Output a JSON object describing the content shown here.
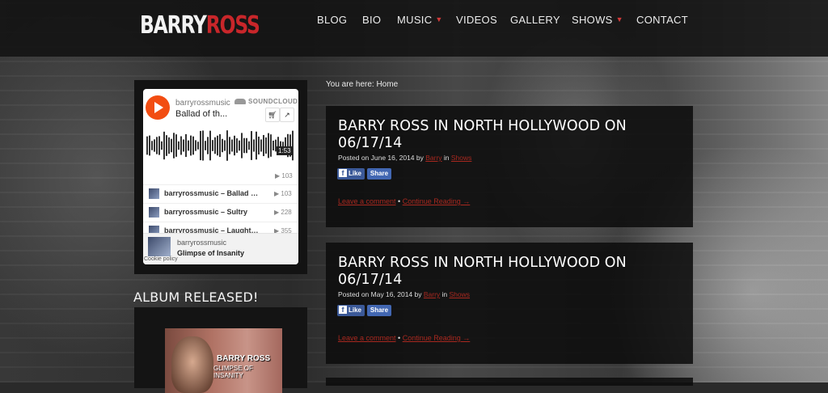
{
  "header": {
    "logo_part1": "BARRY",
    "logo_part2": "ROSS",
    "nav": [
      {
        "label": "BLOG"
      },
      {
        "label": "BIO"
      },
      {
        "label": "MUSIC"
      },
      {
        "label": "VIDEOS"
      },
      {
        "label": "GALLERY"
      },
      {
        "label": "SHOWS"
      },
      {
        "label": "CONTACT"
      }
    ]
  },
  "soundcloud": {
    "user": "barryrossmusic",
    "track_title": "Ballad of th...",
    "brand": "SOUNDCLOUD",
    "duration": "1:53",
    "plays": "103",
    "tracks": [
      {
        "title": "barryrossmusic – Ballad o...",
        "plays": "103"
      },
      {
        "title": "barryrossmusic – Sultry",
        "plays": "228"
      },
      {
        "title": "barryrossmusic – Laughte...",
        "plays": "355"
      }
    ],
    "footer_user": "barryrossmusic",
    "footer_album": "Glimpse of Insanity",
    "cookie": "Cookie policy"
  },
  "sidebar": {
    "album_heading": "ALBUM RELEASED!",
    "album_name": "BARRY ROSS",
    "album_subtitle": "GLIMPSE OF INSANITY"
  },
  "breadcrumb": "You are here: Home",
  "posts": [
    {
      "title": "BARRY ROSS IN NORTH HOLLYWOOD ON 06/17/14",
      "posted_on": "Posted on June 16, 2014 by ",
      "author": "Barry",
      "in": " in ",
      "category": "Shows",
      "like": "Like",
      "share": "Share",
      "comment": "Leave a comment",
      "sep": " • ",
      "continue": "Continue Reading →"
    },
    {
      "title": "BARRY ROSS IN NORTH HOLLYWOOD ON 06/17/14",
      "posted_on": "Posted on May 16, 2014 by ",
      "author": "Barry",
      "in": " in ",
      "category": "Shows",
      "like": "Like",
      "share": "Share",
      "comment": "Leave a comment",
      "sep": " • ",
      "continue": "Continue Reading →"
    }
  ],
  "colors": {
    "accent": "#c8262a",
    "link": "#a8281f",
    "soundcloud": "#f24d12",
    "facebook": "#3b5998"
  }
}
